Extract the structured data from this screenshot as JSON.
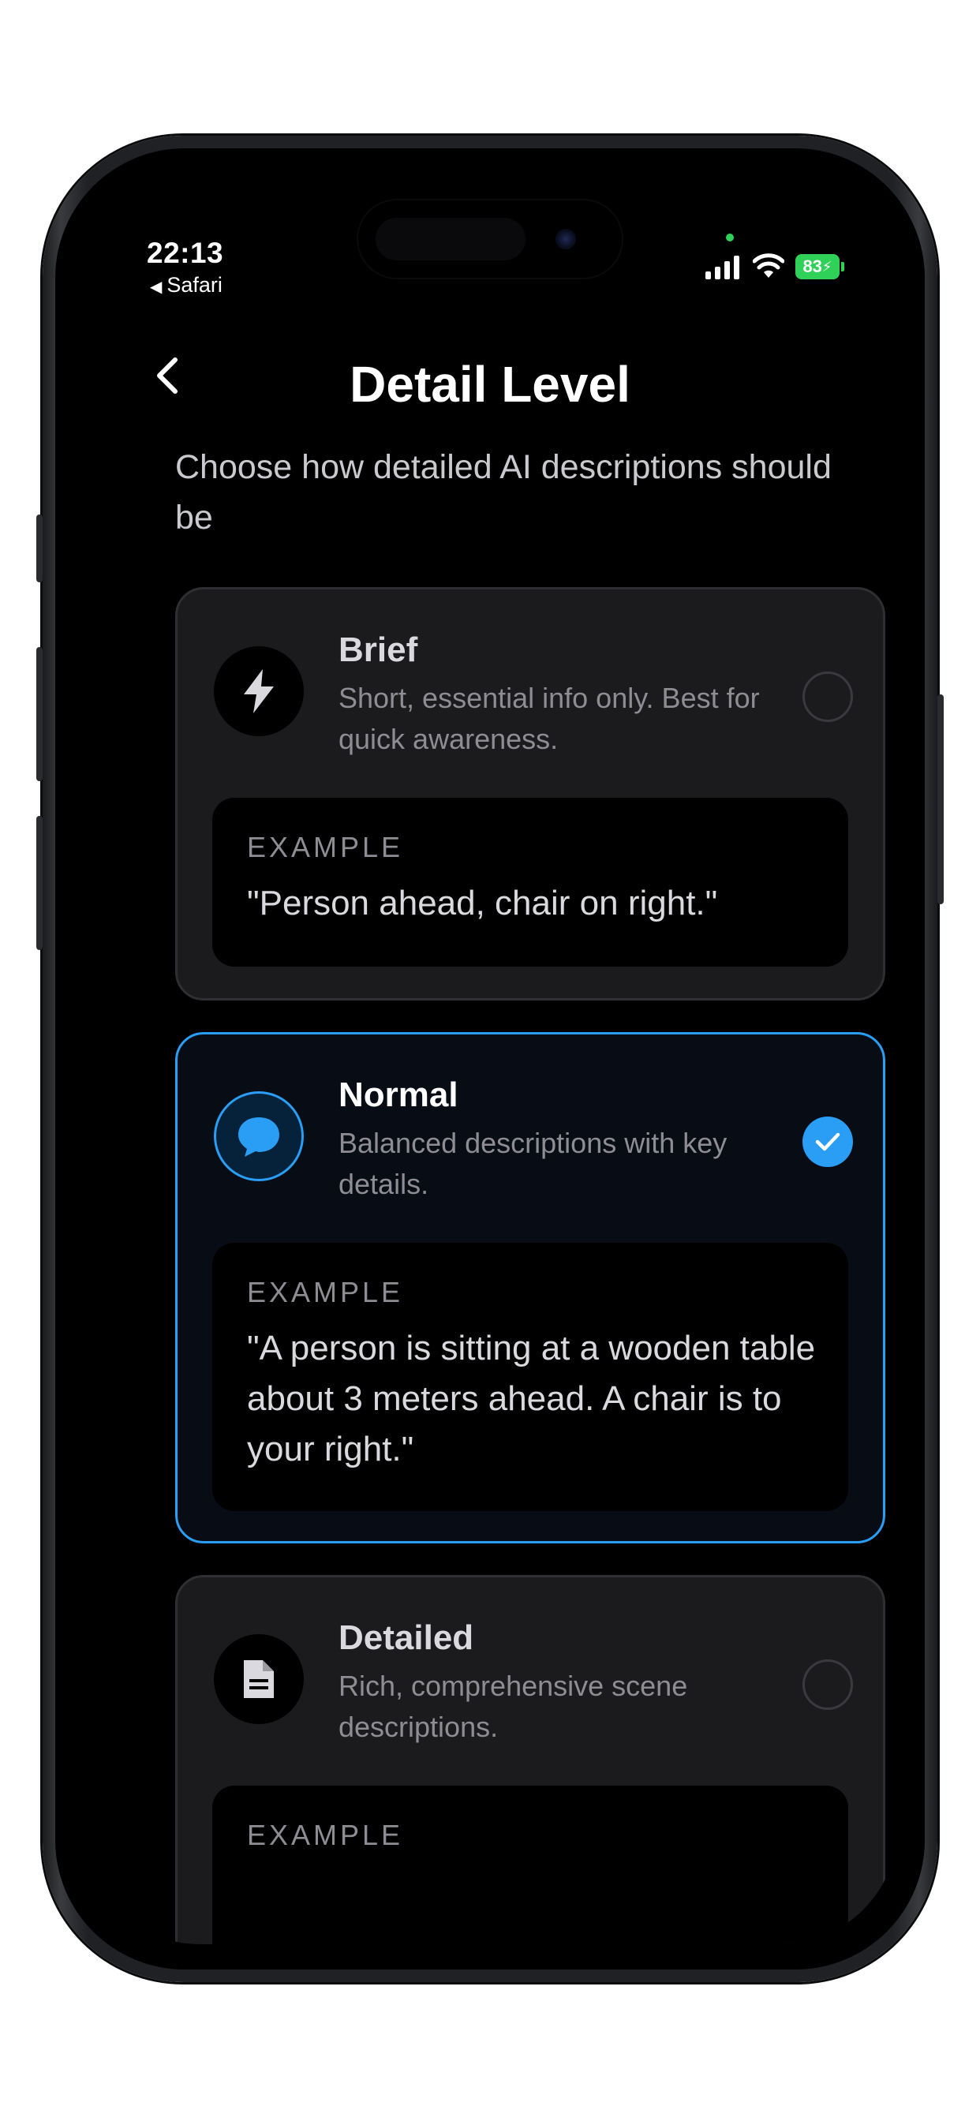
{
  "status_bar": {
    "time": "22:13",
    "back_app": "Safari",
    "battery": "83"
  },
  "header": {
    "title": "Detail Level"
  },
  "subtitle": "Choose how detailed AI descriptions should be",
  "options": [
    {
      "name": "Brief",
      "description": "Short, essential info only. Best for quick awareness.",
      "example_label": "EXAMPLE",
      "example_text": "\"Person ahead, chair on right.\"",
      "icon": "lightning-icon",
      "selected": false
    },
    {
      "name": "Normal",
      "description": "Balanced descriptions with key details.",
      "example_label": "EXAMPLE",
      "example_text": "\"A person is sitting at a wooden table about 3 meters ahead. A chair is to your right.\"",
      "icon": "chat-bubble-icon",
      "selected": true
    },
    {
      "name": "Detailed",
      "description": "Rich, comprehensive scene descriptions.",
      "example_label": "EXAMPLE",
      "example_text": "",
      "icon": "document-icon",
      "selected": false
    }
  ],
  "colors": {
    "accent": "#2a9df4",
    "card_bg": "#1b1b1e",
    "selected_card_bg": "#070c15",
    "battery": "#30d158"
  }
}
